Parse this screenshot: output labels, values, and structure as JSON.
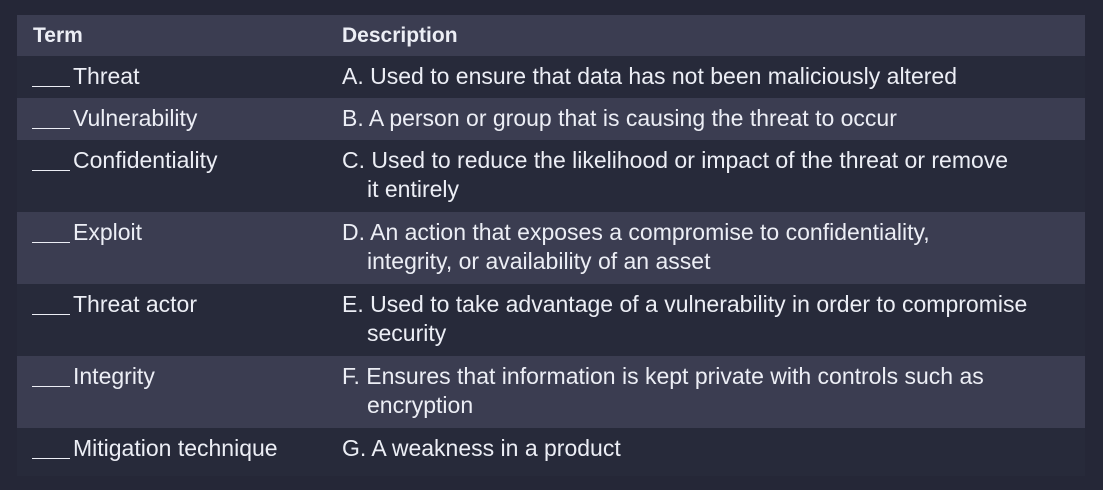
{
  "header": {
    "term": "Term",
    "description": "Description"
  },
  "rows": [
    {
      "term": "Threat",
      "description_lines": [
        "A. Used to ensure that data has not been maliciously altered"
      ]
    },
    {
      "term": "Vulnerability",
      "description_lines": [
        "B. A person or group that is causing the threat to occur"
      ]
    },
    {
      "term": "Confidentiality",
      "description_lines": [
        "C. Used to reduce the likelihood or impact of the threat or remove",
        "it entirely"
      ]
    },
    {
      "term": "Exploit",
      "description_lines": [
        "D. An action that exposes a compromise to confidentiality,",
        "integrity, or availability of an asset"
      ]
    },
    {
      "term": "Threat actor",
      "description_lines": [
        "E. Used to take advantage of a vulnerability in order to compromise",
        "security"
      ]
    },
    {
      "term": "Integrity",
      "description_lines": [
        "F. Ensures that information is kept private with controls such as",
        "encryption"
      ]
    },
    {
      "term": "Mitigation technique",
      "description_lines": [
        "G. A weakness in a product"
      ]
    }
  ],
  "colors": {
    "background": "#252737",
    "row_light": "#3b3d51",
    "row_dark": "#272a3a",
    "text": "#eceef5"
  }
}
